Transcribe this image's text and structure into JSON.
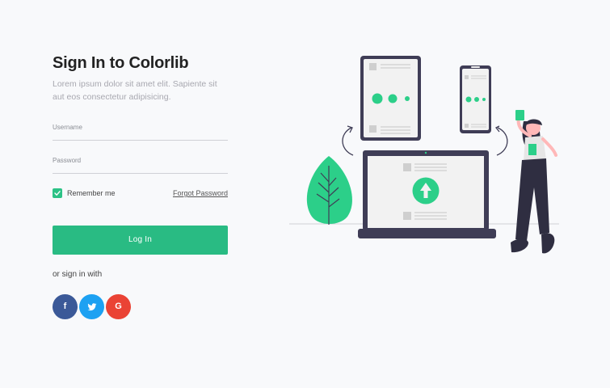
{
  "form": {
    "title": "Sign In to Colorlib",
    "subtitle": "Lorem ipsum dolor sit amet elit. Sapiente sit aut eos consectetur adipisicing.",
    "username_label": "Username",
    "password_label": "Password",
    "remember_label": "Remember me",
    "remember_checked": true,
    "forgot_label": "Forgot Password",
    "login_label": "Log In",
    "or_text": "or sign in with"
  },
  "social": {
    "facebook": "f",
    "twitter": "twitter-bird-icon",
    "google": "G"
  },
  "colors": {
    "accent": "#29bb83",
    "facebook": "#3b5998",
    "twitter": "#1da1f2",
    "google": "#ea4335",
    "background": "#f8f9fb",
    "dark": "#3f3d56"
  }
}
